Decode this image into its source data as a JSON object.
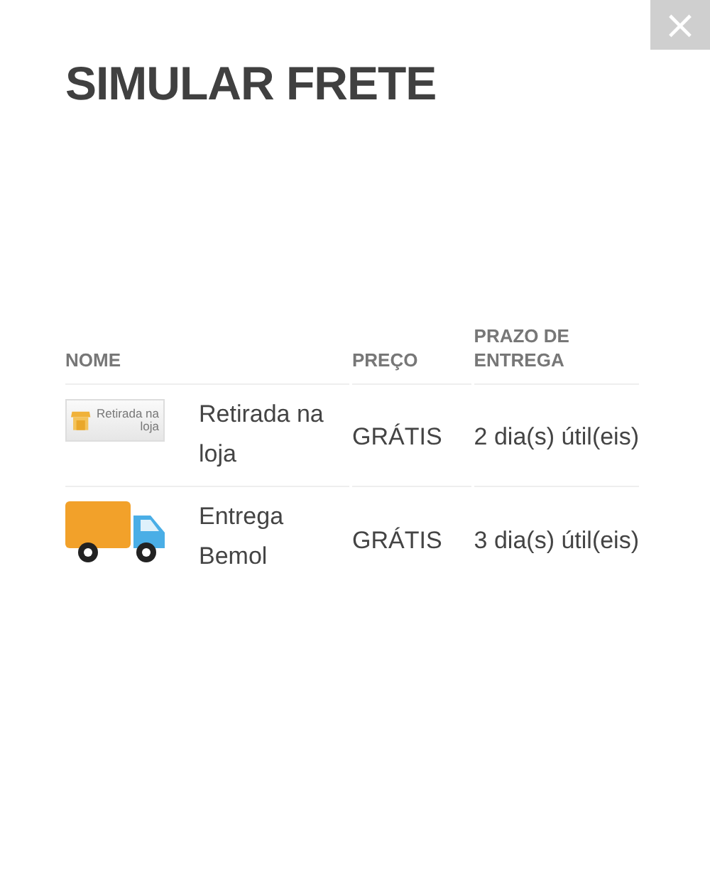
{
  "close_button": {
    "label": "×"
  },
  "title": "SIMULAR FRETE",
  "table": {
    "columns": [
      "NOME",
      "PREÇO",
      "PRAZO DE ENTREGA"
    ],
    "rows": [
      {
        "kind": "store",
        "badge": "Retirada na loja",
        "name": "Retirada na loja",
        "price": "GRÁTIS",
        "deadline": "2 dia(s) útil(eis)"
      },
      {
        "kind": "truck",
        "name": "Entrega Bemol",
        "price": "GRÁTIS",
        "deadline": "3 dia(s) útil(eis)"
      }
    ]
  }
}
